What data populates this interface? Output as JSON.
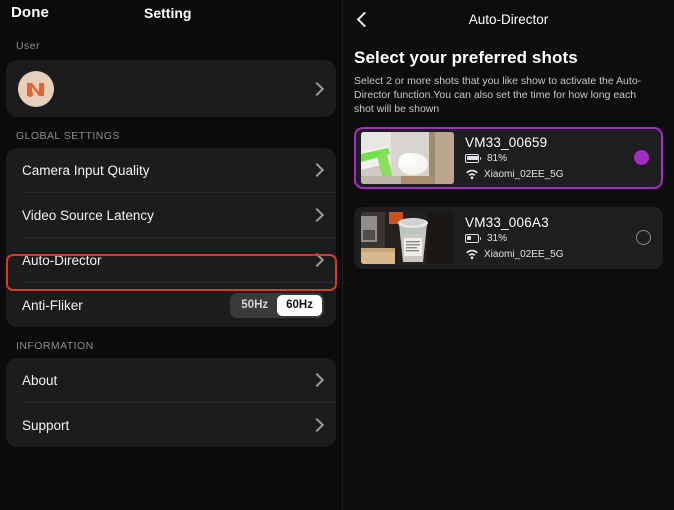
{
  "left": {
    "done_label": "Done",
    "title": "Setting",
    "user_section_label": "User",
    "user_name_redacted": "",
    "global_section_label": "GLOBAL SETTINGS",
    "global_items": [
      {
        "label": "Camera Input Quality",
        "accessory": "chevron"
      },
      {
        "label": "Video Source Latency",
        "accessory": "chevron"
      },
      {
        "label": "Auto-Director",
        "accessory": "chevron",
        "highlighted": true
      }
    ],
    "anti_flicker": {
      "label": "Anti-Fliker",
      "options": [
        "50Hz",
        "60Hz"
      ],
      "selected": "60Hz"
    },
    "information_section_label": "INFORMATION",
    "information_items": [
      {
        "label": "About",
        "accessory": "chevron"
      },
      {
        "label": "Support",
        "accessory": "chevron"
      }
    ],
    "highlight_color": "#d93b1f"
  },
  "right": {
    "back_label": "",
    "title": "Auto-Director",
    "heading": "Select your preferred shots",
    "description": "Select 2 or more shots that you like show to activate the Auto-Director function.You can also set the time for how long each shot will be shown",
    "accent_color": "#a32cc4",
    "shots": [
      {
        "name": "VM33_00659",
        "battery": "81%",
        "battery_level": 81,
        "wifi": "Xiaomi_02EE_5G",
        "selected": true
      },
      {
        "name": "VM33_006A3",
        "battery": "31%",
        "battery_level": 31,
        "wifi": "Xiaomi_02EE_5G",
        "selected": false
      }
    ]
  }
}
